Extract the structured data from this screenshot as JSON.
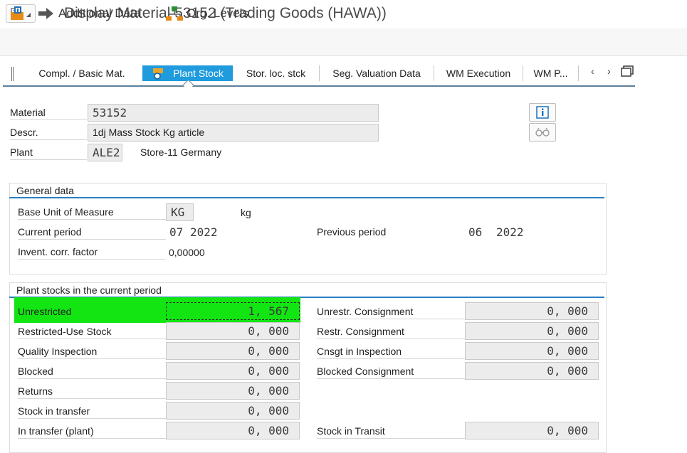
{
  "window": {
    "title": "Display Material 53152 (Trading Goods (HAWA))"
  },
  "toolbar": {
    "additional_data": "Additional Data",
    "org_levels": "Org. Levels"
  },
  "tabs": [
    {
      "label": "Compl. / Basic Mat."
    },
    {
      "label": "Plant Stock"
    },
    {
      "label": "Stor. loc. stck"
    },
    {
      "label": "Seg. Valuation Data"
    },
    {
      "label": "WM Execution"
    },
    {
      "label": "WM P..."
    }
  ],
  "header": {
    "material_label": "Material",
    "material_value": "53152",
    "descr_label": "Descr.",
    "descr_value": "1dj Mass Stock Kg article",
    "plant_label": "Plant",
    "plant_value": "ALE2",
    "plant_name": "Store-11 Germany"
  },
  "general": {
    "title": "General data",
    "base_uom_label": "Base Unit of Measure",
    "base_uom_value": "KG",
    "base_uom_text": "kg",
    "current_period_label": "Current period",
    "current_period_month": "07",
    "current_period_year": "2022",
    "previous_period_label": "Previous period",
    "previous_period_month": "06",
    "previous_period_year": "2022",
    "invent_factor_label": "Invent. corr. factor",
    "invent_factor_value": "0,00000"
  },
  "stocks": {
    "title": "Plant stocks in the current period",
    "left": [
      {
        "label": "Unrestricted",
        "value": "1, 567"
      },
      {
        "label": "Restricted-Use Stock",
        "value": "0, 000"
      },
      {
        "label": "Quality Inspection",
        "value": "0, 000"
      },
      {
        "label": "Blocked",
        "value": "0, 000"
      },
      {
        "label": "Returns",
        "value": "0, 000"
      },
      {
        "label": "Stock in transfer",
        "value": "0, 000"
      },
      {
        "label": "In transfer (plant)",
        "value": "0, 000"
      }
    ],
    "right": [
      {
        "label": "Unrestr. Consignment",
        "value": "0, 000"
      },
      {
        "label": "Restr. Consignment",
        "value": "0, 000"
      },
      {
        "label": "Cnsgt in Inspection",
        "value": "0, 000"
      },
      {
        "label": "Blocked Consignment",
        "value": "0, 000"
      },
      {
        "label": "Stock in Transit",
        "value": "0, 000"
      }
    ]
  },
  "colors": {
    "active_tab": "#1f9bde",
    "highlight": "#13e513",
    "section_underline": "#2b80c4"
  },
  "icons": [
    "menu-icon",
    "change-display-icon",
    "arrow-right-icon",
    "org-levels-icon",
    "plant-stock-tab-icon",
    "scroll-left-icon",
    "scroll-right-icon",
    "tab-list-icon",
    "info-icon",
    "glasses-icon"
  ]
}
